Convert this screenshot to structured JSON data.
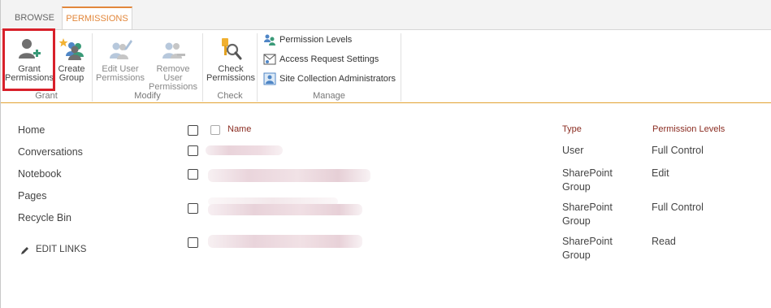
{
  "tabs": {
    "browse": "BROWSE",
    "permissions": "PERMISSIONS"
  },
  "ribbon": {
    "groups": {
      "grant": "Grant",
      "modify": "Modify",
      "check": "Check",
      "manage": "Manage"
    },
    "grant_permissions": {
      "line1": "Grant",
      "line2": "Permissions"
    },
    "create_group": {
      "line1": "Create",
      "line2": "Group"
    },
    "edit_user_permissions": {
      "line1": "Edit User",
      "line2": "Permissions"
    },
    "remove_user_permissions": {
      "line1": "Remove User",
      "line2": "Permissions"
    },
    "check_permissions": {
      "line1": "Check",
      "line2": "Permissions"
    },
    "manage_items": [
      "Permission Levels",
      "Access Request Settings",
      "Site Collection Administrators"
    ]
  },
  "nav": {
    "items": [
      "Home",
      "Conversations",
      "Notebook",
      "Pages",
      "Recycle Bin"
    ],
    "edit_links": "EDIT LINKS"
  },
  "list": {
    "headers": {
      "name": "Name",
      "type": "Type",
      "permission_levels": "Permission Levels"
    },
    "rows": [
      {
        "type_line1": "User",
        "type_line2": "",
        "permission": "Full Control"
      },
      {
        "type_line1": "SharePoint",
        "type_line2": "Group",
        "permission": "Edit"
      },
      {
        "type_line1": "SharePoint",
        "type_line2": "Group",
        "permission": "Full Control"
      },
      {
        "type_line1": "SharePoint",
        "type_line2": "Group",
        "permission": "Read"
      }
    ]
  },
  "colors": {
    "accent": "#e2873b",
    "highlight": "#d8202a",
    "header_text": "#8b2d22"
  }
}
